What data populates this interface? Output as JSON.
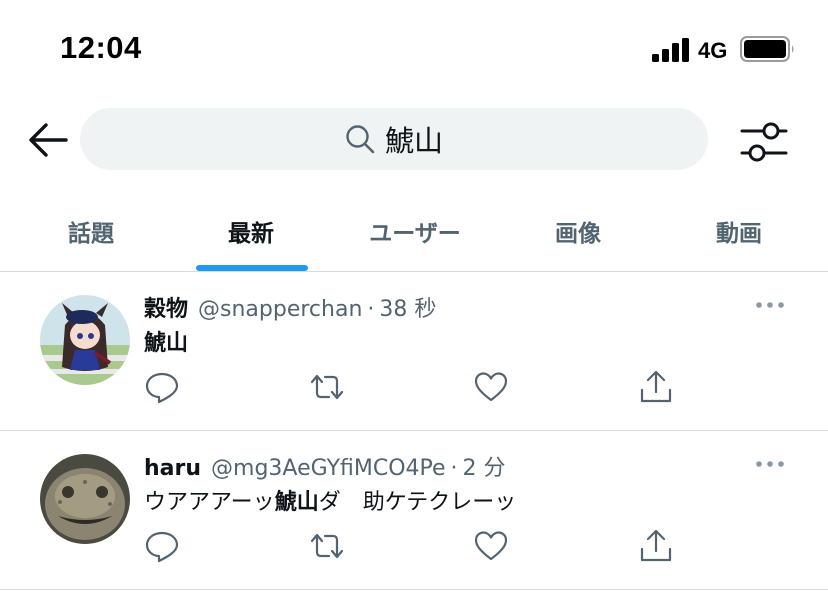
{
  "status_bar": {
    "time": "12:04",
    "network": "4G"
  },
  "search": {
    "query": "鯱山"
  },
  "tabs": [
    {
      "label": "話題",
      "active": false
    },
    {
      "label": "最新",
      "active": true
    },
    {
      "label": "ユーザー",
      "active": false
    },
    {
      "label": "画像",
      "active": false
    },
    {
      "label": "動画",
      "active": false
    }
  ],
  "tweets": [
    {
      "display_name": "穀物",
      "handle": "@snapperchan",
      "dot": "·",
      "time": "38 秒",
      "text_before": "",
      "text_highlight": "鯱山",
      "text_after": ""
    },
    {
      "display_name": "haru",
      "handle": "@mg3AeGYfiMCO4Pe",
      "dot": "·",
      "time": "2 分",
      "text_before": "ウアアアーッ",
      "text_highlight": "鯱山",
      "text_after": "ダ　助ケテクレーッ"
    }
  ],
  "colors": {
    "accent": "#1d9bf0",
    "secondary_text": "#536471",
    "search_bg": "#eff3f4",
    "divider": "#d7dbdc"
  }
}
